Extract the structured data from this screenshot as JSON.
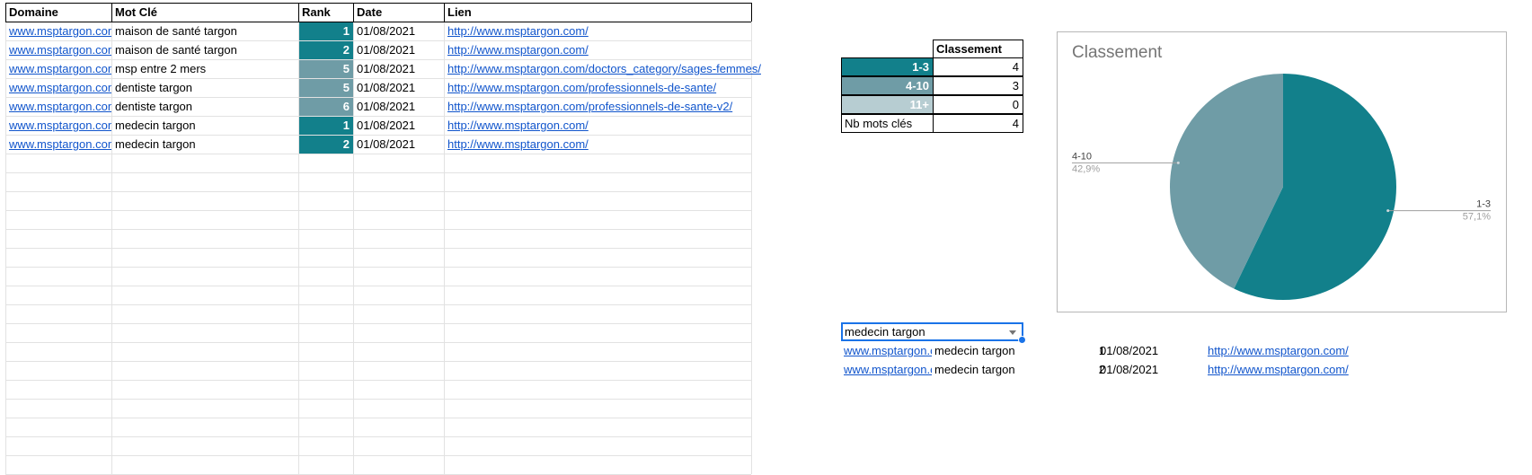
{
  "colors": {
    "rank_dark": "#12808b",
    "rank_mid": "#6f9ca6",
    "rank_light": "#b7cdd2",
    "link": "#1155cc",
    "selection": "#1a73e8"
  },
  "main_table": {
    "headers": [
      "Domaine",
      "Mot Clé",
      "Rank",
      "Date",
      "Lien"
    ],
    "rows": [
      {
        "domaine": "www.msptargon.com",
        "mot_cle": "maison de santé targon",
        "rank": "1",
        "date": "01/08/2021",
        "lien": "http://www.msptargon.com/"
      },
      {
        "domaine": "www.msptargon.com",
        "mot_cle": "maison de santé targon",
        "rank": "2",
        "date": "01/08/2021",
        "lien": "http://www.msptargon.com/"
      },
      {
        "domaine": "www.msptargon.com",
        "mot_cle": "msp entre 2 mers",
        "rank": "5",
        "date": "01/08/2021",
        "lien": "http://www.msptargon.com/doctors_category/sages-femmes/"
      },
      {
        "domaine": "www.msptargon.com",
        "mot_cle": "dentiste targon",
        "rank": "5",
        "date": "01/08/2021",
        "lien": "http://www.msptargon.com/professionnels-de-sante/"
      },
      {
        "domaine": "www.msptargon.com",
        "mot_cle": "dentiste targon",
        "rank": "6",
        "date": "01/08/2021",
        "lien": "http://www.msptargon.com/professionnels-de-sante-v2/"
      },
      {
        "domaine": "www.msptargon.com",
        "mot_cle": "medecin targon",
        "rank": "1",
        "date": "01/08/2021",
        "lien": "http://www.msptargon.com/"
      },
      {
        "domaine": "www.msptargon.com",
        "mot_cle": "medecin targon",
        "rank": "2",
        "date": "01/08/2021",
        "lien": "http://www.msptargon.com/"
      }
    ]
  },
  "summary_table": {
    "header": "Classement",
    "rows": [
      {
        "label": "1-3",
        "value": "4"
      },
      {
        "label": "4-10",
        "value": "3"
      },
      {
        "label": "11+",
        "value": "0"
      },
      {
        "label": "Nb mots clés",
        "value": "4"
      }
    ]
  },
  "chart_data": {
    "type": "pie",
    "title": "Classement",
    "slices": [
      {
        "label": "1-3",
        "value": 4,
        "percent": "57,1%",
        "color": "#12808b"
      },
      {
        "label": "4-10",
        "value": 3,
        "percent": "42,9%",
        "color": "#6f9ca6"
      }
    ]
  },
  "filter": {
    "selected": "medecin targon",
    "results": [
      {
        "domaine": "www.msptargon.com",
        "mot_cle": "medecin targon",
        "rank": "1",
        "date": "01/08/2021",
        "lien": "http://www.msptargon.com/"
      },
      {
        "domaine": "www.msptargon.com",
        "mot_cle": "medecin targon",
        "rank": "2",
        "date": "01/08/2021",
        "lien": "http://www.msptargon.com/"
      }
    ]
  }
}
